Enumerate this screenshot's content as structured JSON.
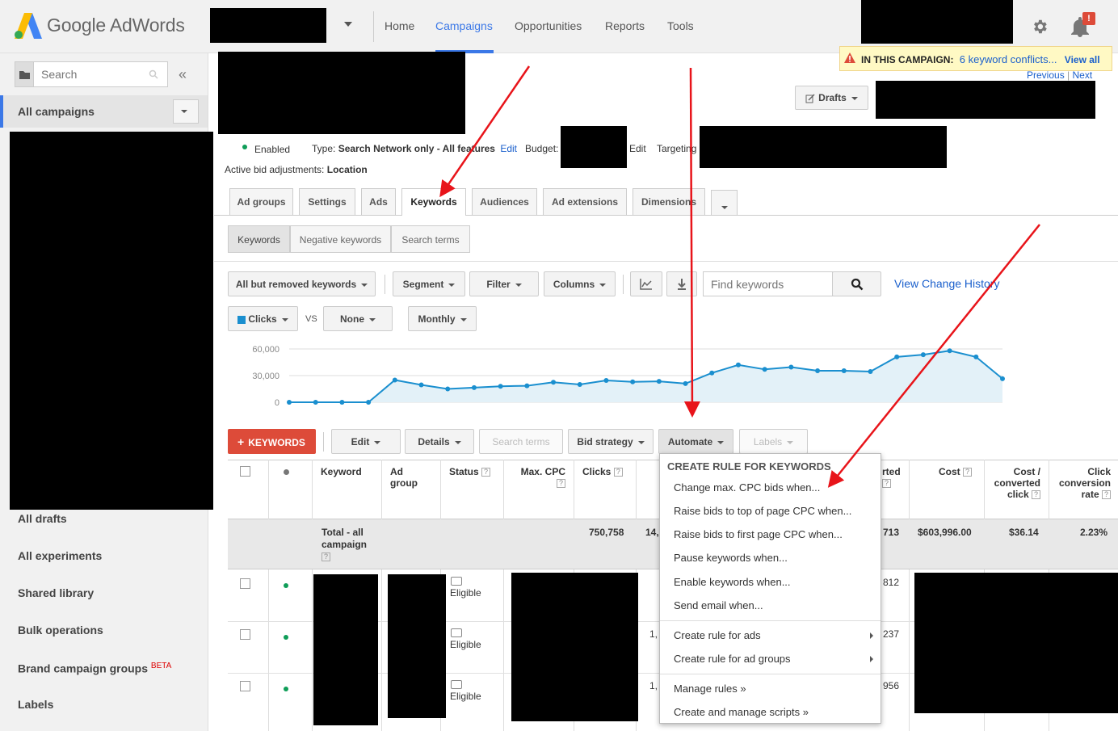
{
  "header": {
    "logo_text": "Google AdWords",
    "nav": [
      "Home",
      "Campaigns",
      "Opportunities",
      "Reports",
      "Tools"
    ],
    "notification_badge": "!",
    "accent": "#3b78e7"
  },
  "sidebar": {
    "search_placeholder": "Search",
    "collapse": "«",
    "all_campaigns": "All campaigns",
    "items": [
      "All drafts",
      "All experiments",
      "Shared library",
      "Bulk operations",
      "Brand campaign groups",
      "Labels"
    ],
    "beta": "BETA"
  },
  "alert": {
    "prefix": "IN THIS CAMPAIGN:",
    "message": "6 keyword conflicts...",
    "view_all": "View all"
  },
  "pager": {
    "previous": "Previous",
    "sep": "|",
    "next": "Next"
  },
  "drafts_label": "Drafts",
  "campaign": {
    "status": "Enabled",
    "type_label": "Type:",
    "type_value": "Search Network only - All features",
    "edit": "Edit",
    "budget_label": "Budget:",
    "targeting_label": "Targeting",
    "bid_adj_label": "Active bid adjustments:",
    "bid_adj_value": "Location"
  },
  "tabs": [
    "Ad groups",
    "Settings",
    "Ads",
    "Keywords",
    "Audiences",
    "Ad extensions",
    "Dimensions"
  ],
  "subtabs": [
    "Keywords",
    "Negative keywords",
    "Search terms"
  ],
  "toolbar": {
    "filter_view": "All but removed keywords",
    "segment": "Segment",
    "filter": "Filter",
    "columns": "Columns",
    "find_placeholder": "Find keywords",
    "change_history": "View Change History",
    "metric1": "Clicks",
    "vs": "VS",
    "metric2": "None",
    "period": "Monthly"
  },
  "chart_data": {
    "type": "area",
    "series": [
      {
        "values": [
          0,
          0,
          0,
          0,
          25000,
          19500,
          15000,
          16500,
          18000,
          18500,
          22500,
          20000,
          24500,
          23000,
          23500,
          21000,
          33000,
          42000,
          37000,
          39500,
          35500,
          35500,
          34500,
          51000,
          53500,
          58000,
          51000,
          26500
        ]
      }
    ],
    "yticks": [
      "60,000",
      "30,000",
      "0"
    ],
    "ylim": [
      0,
      60000
    ],
    "color": "#1a8fcf",
    "fill": "#e3f1f8"
  },
  "actions": {
    "add_keywords": "KEYWORDS",
    "edit": "Edit",
    "details": "Details",
    "search_terms": "Search terms",
    "bid_strategy": "Bid strategy",
    "automate": "Automate",
    "labels": "Labels"
  },
  "table": {
    "headers": {
      "keyword": "Keyword",
      "ad_group": "Ad group",
      "status": "Status",
      "max_cpc": "Max. CPC",
      "clicks": "Clicks",
      "converted": "rted",
      "cost": "Cost",
      "cost_per_conv": "Cost / converted click",
      "conv_rate": "Click conversion rate"
    },
    "total": {
      "label": "Total - all campaign",
      "clicks": "750,758",
      "impr_partial": "14,",
      "conv_partial": "713",
      "cost": "$603,996.00",
      "cost_per_conv": "$36.14",
      "conv_rate": "2.23%"
    },
    "rows": [
      {
        "status": "Eligible",
        "col_partial": "",
        "conv_partial": "812"
      },
      {
        "status": "Eligible",
        "col_partial": "1,",
        "conv_partial": "237"
      },
      {
        "status": "Eligible",
        "col_partial": "1,",
        "conv_partial": "956"
      }
    ]
  },
  "menu": {
    "heading": "CREATE RULE FOR KEYWORDS",
    "items": [
      "Change max. CPC bids when...",
      "Raise bids to top of page CPC when...",
      "Raise bids to first page CPC when...",
      "Pause keywords when...",
      "Enable keywords when...",
      "Send email when..."
    ],
    "sub_items": [
      "Create rule for ads",
      "Create rule for ad groups"
    ],
    "links": [
      "Manage rules »",
      "Create and manage scripts »"
    ]
  }
}
